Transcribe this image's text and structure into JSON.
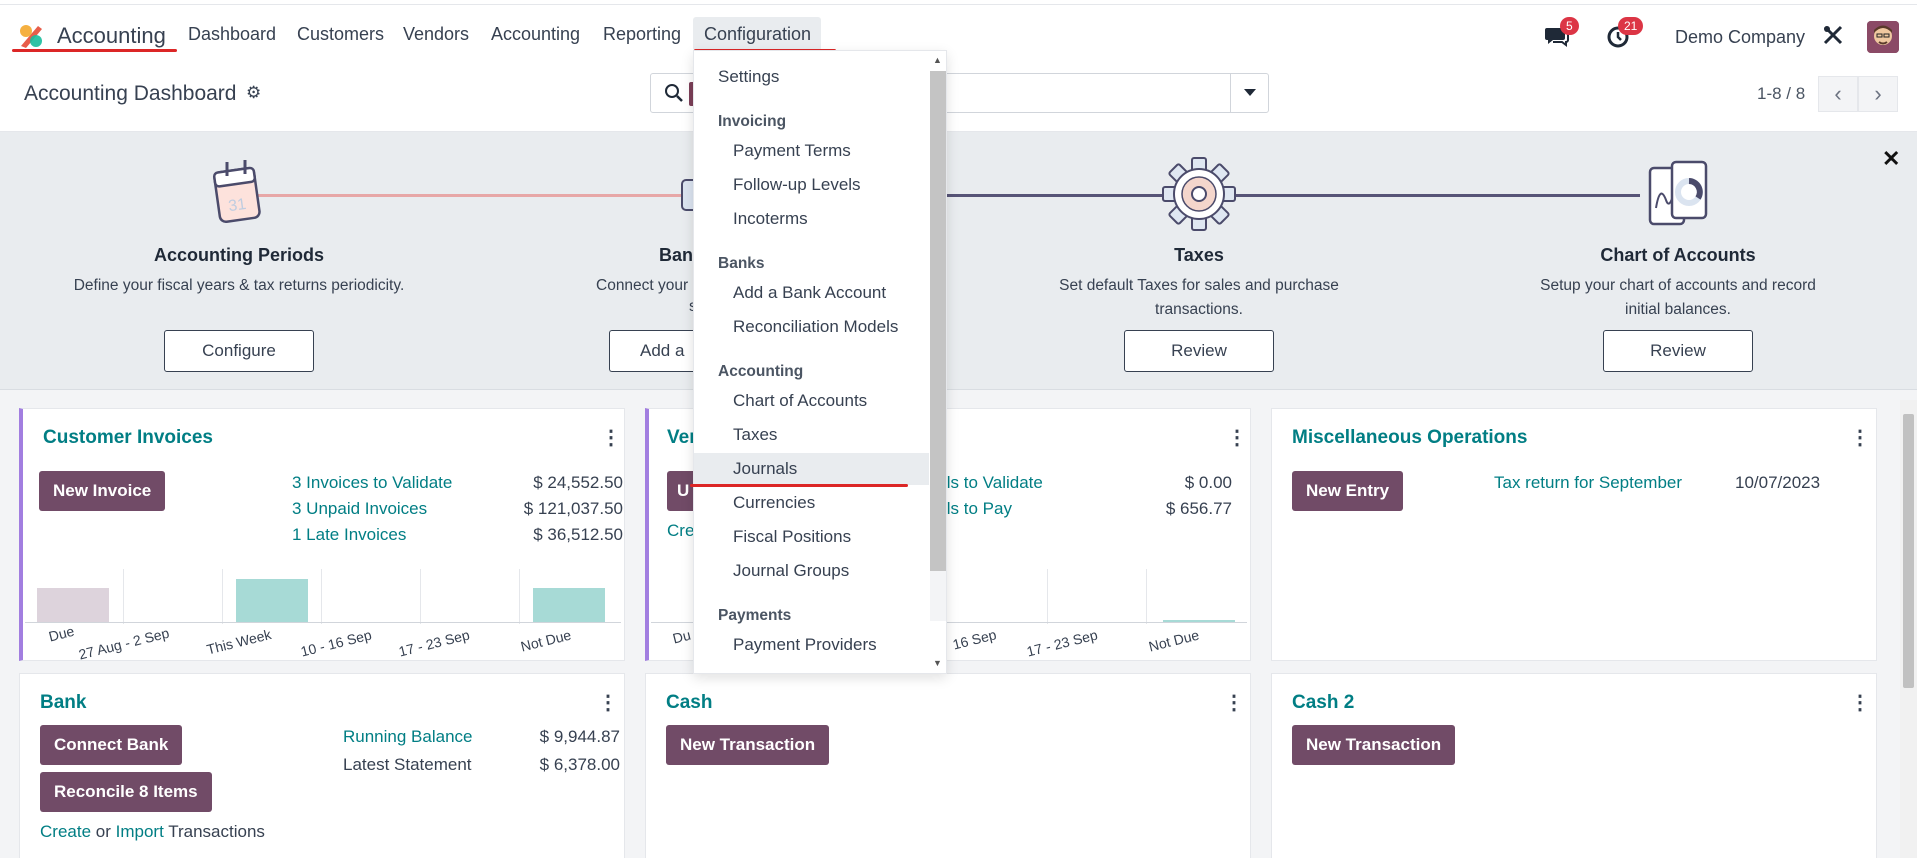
{
  "navbar": {
    "app_name": "Accounting",
    "menus": [
      "Dashboard",
      "Customers",
      "Vendors",
      "Accounting",
      "Reporting",
      "Configuration"
    ],
    "messages_count": "5",
    "activities_count": "21",
    "company": "Demo Company"
  },
  "control_panel": {
    "title": "Accounting Dashboard",
    "pager": "1-8 / 8"
  },
  "onboarding": {
    "steps": [
      {
        "title": "Accounting Periods",
        "desc": "Define your fiscal years & tax returns periodicity.",
        "button": "Configure"
      },
      {
        "title": "Ban",
        "desc": "Connect your",
        "desc2": "s",
        "button": "Add a"
      },
      {
        "title": "Taxes",
        "desc": "Set default Taxes for sales and purchase transactions.",
        "button": "Review"
      },
      {
        "title": "Chart of Accounts",
        "desc": "Setup your chart of accounts and record initial balances.",
        "button": "Review"
      }
    ],
    "colors": {
      "line1": "#e7a7a7",
      "line2": "#575477"
    }
  },
  "cards": {
    "customer_invoices": {
      "title": "Customer Invoices",
      "button": "New Invoice",
      "rows": [
        {
          "label": "3 Invoices to Validate",
          "amount": "$ 24,552.50"
        },
        {
          "label": "3 Unpaid Invoices",
          "amount": "$ 121,037.50"
        },
        {
          "label": "1 Late Invoices",
          "amount": "$ 36,512.50"
        }
      ],
      "chart_ticks": [
        "Due",
        "27 Aug - 2 Sep",
        "This Week",
        "10 - 16 Sep",
        "17 - 23 Sep",
        "Not Due"
      ]
    },
    "vendor_bills": {
      "title": "Ven",
      "button": "U",
      "create_link": "Cre",
      "rows": [
        {
          "label": "lls to Validate",
          "amount": "$ 0.00"
        },
        {
          "label": "lls to Pay",
          "amount": "$ 656.77"
        }
      ],
      "chart_ticks": [
        "Du",
        "16 Sep",
        "17 - 23 Sep",
        "Not Due"
      ]
    },
    "misc": {
      "title": "Miscellaneous Operations",
      "button": "New Entry",
      "row_label": "Tax return for September",
      "row_date": "10/07/2023"
    },
    "bank": {
      "title": "Bank",
      "button1": "Connect Bank",
      "button2": "Reconcile 8 Items",
      "running_label": "Running Balance",
      "running_amount": "$ 9,944.87",
      "latest_label": "Latest Statement",
      "latest_amount": "$ 6,378.00",
      "footer_create": "Create",
      "footer_or": "or",
      "footer_import": "Import",
      "footer_trans": "Transactions"
    },
    "cash": {
      "title": "Cash",
      "button": "New Transaction"
    },
    "cash2": {
      "title": "Cash 2",
      "button": "New Transaction"
    }
  },
  "chart_data": {
    "type": "bar",
    "categories": [
      "Due",
      "27 Aug - 2 Sep",
      "This Week",
      "10 - 16 Sep",
      "17 - 23 Sep",
      "Not Due"
    ],
    "values": [
      1,
      0,
      1.3,
      0,
      0,
      1
    ]
  },
  "dropdown": {
    "settings": "Settings",
    "sections": [
      {
        "name": "Invoicing",
        "items": [
          "Payment Terms",
          "Follow-up Levels",
          "Incoterms"
        ]
      },
      {
        "name": "Banks",
        "items": [
          "Add a Bank Account",
          "Reconciliation Models"
        ]
      },
      {
        "name": "Accounting",
        "items": [
          "Chart of Accounts",
          "Taxes",
          "Journals",
          "Currencies",
          "Fiscal Positions",
          "Journal Groups"
        ]
      },
      {
        "name": "Payments",
        "items": [
          "Payment Providers"
        ]
      }
    ],
    "highlighted": "Journals"
  }
}
